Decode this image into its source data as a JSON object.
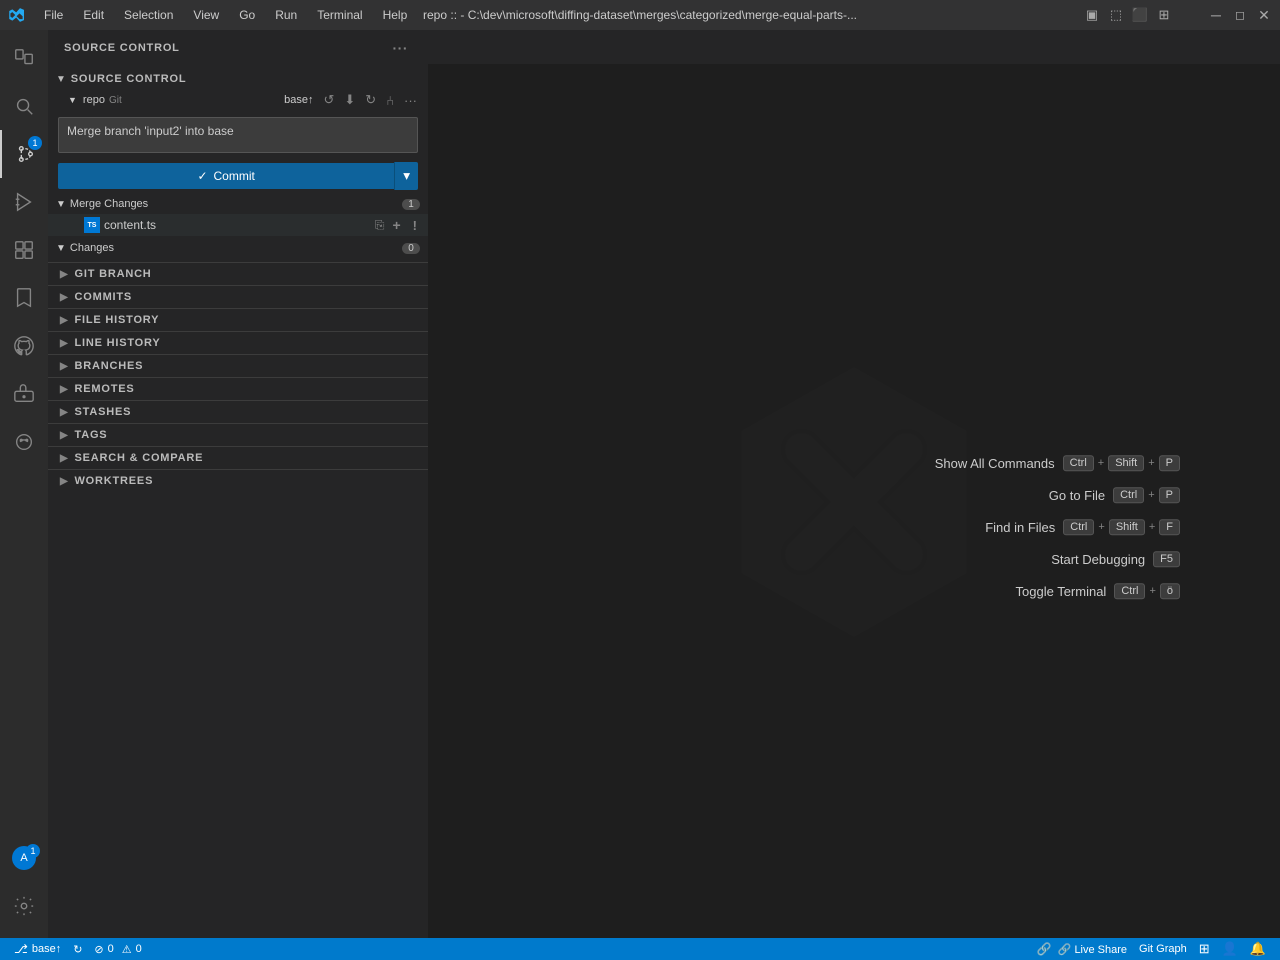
{
  "titlebar": {
    "title": "repo :: - C:\\dev\\microsoft\\diffing-dataset\\merges\\categorized\\merge-equal-parts-...",
    "menu": [
      "File",
      "Edit",
      "Selection",
      "View",
      "Go",
      "Run",
      "Terminal",
      "Help"
    ],
    "controls": [
      "⬜",
      "❐",
      "✕"
    ]
  },
  "sidebar": {
    "header": "SOURCE CONTROL",
    "more_label": "···",
    "source_control_section": "SOURCE CONTROL",
    "repo_name": "repo",
    "repo_vcs": "Git",
    "branch_name": "base↑",
    "commit_message": "Merge branch 'input2' into base",
    "commit_button": "✓ Commit",
    "merge_changes_label": "Merge Changes",
    "merge_changes_count": "1",
    "changes_label": "Changes",
    "changes_count": "0",
    "file": {
      "name": "content.ts",
      "status": "!"
    }
  },
  "collapsed_sections": [
    {
      "id": "git-branch",
      "label": "GIT BRANCH"
    },
    {
      "id": "commits",
      "label": "COMMITS"
    },
    {
      "id": "file-history",
      "label": "FILE HISTORY"
    },
    {
      "id": "line-history",
      "label": "LINE HISTORY"
    },
    {
      "id": "branches",
      "label": "BRANCHES"
    },
    {
      "id": "remotes",
      "label": "REMOTES"
    },
    {
      "id": "stashes",
      "label": "STASHES"
    },
    {
      "id": "tags",
      "label": "TAGS"
    },
    {
      "id": "search-compare",
      "label": "SEARCH & COMPARE"
    },
    {
      "id": "worktrees",
      "label": "WORKTREES"
    }
  ],
  "shortcuts": [
    {
      "label": "Show All Commands",
      "keys": [
        "Ctrl",
        "+",
        "Shift",
        "+",
        "P"
      ]
    },
    {
      "label": "Go to File",
      "keys": [
        "Ctrl",
        "+",
        "P"
      ]
    },
    {
      "label": "Find in Files",
      "keys": [
        "Ctrl",
        "+",
        "Shift",
        "+",
        "F"
      ]
    },
    {
      "label": "Start Debugging",
      "keys": [
        "F5"
      ]
    },
    {
      "label": "Toggle Terminal",
      "keys": [
        "Ctrl",
        "+",
        "ö"
      ]
    }
  ],
  "statusbar": {
    "branch": "⎇  base↑",
    "sync": "↻",
    "errors": "⊘ 0  ⚠ 0",
    "liveshare": "🔗 Live Share",
    "git_graph": "Git Graph",
    "remote": "🔲",
    "bell": "🔔",
    "account": "👤"
  },
  "colors": {
    "activity_bar_bg": "#2c2c2c",
    "sidebar_bg": "#252526",
    "editor_bg": "#1e1e1e",
    "statusbar_bg": "#007acc",
    "commit_btn_bg": "#0e639c",
    "file_merge_icon_bg": "#0078d4",
    "active_file_bg": "#2a2d2e"
  }
}
